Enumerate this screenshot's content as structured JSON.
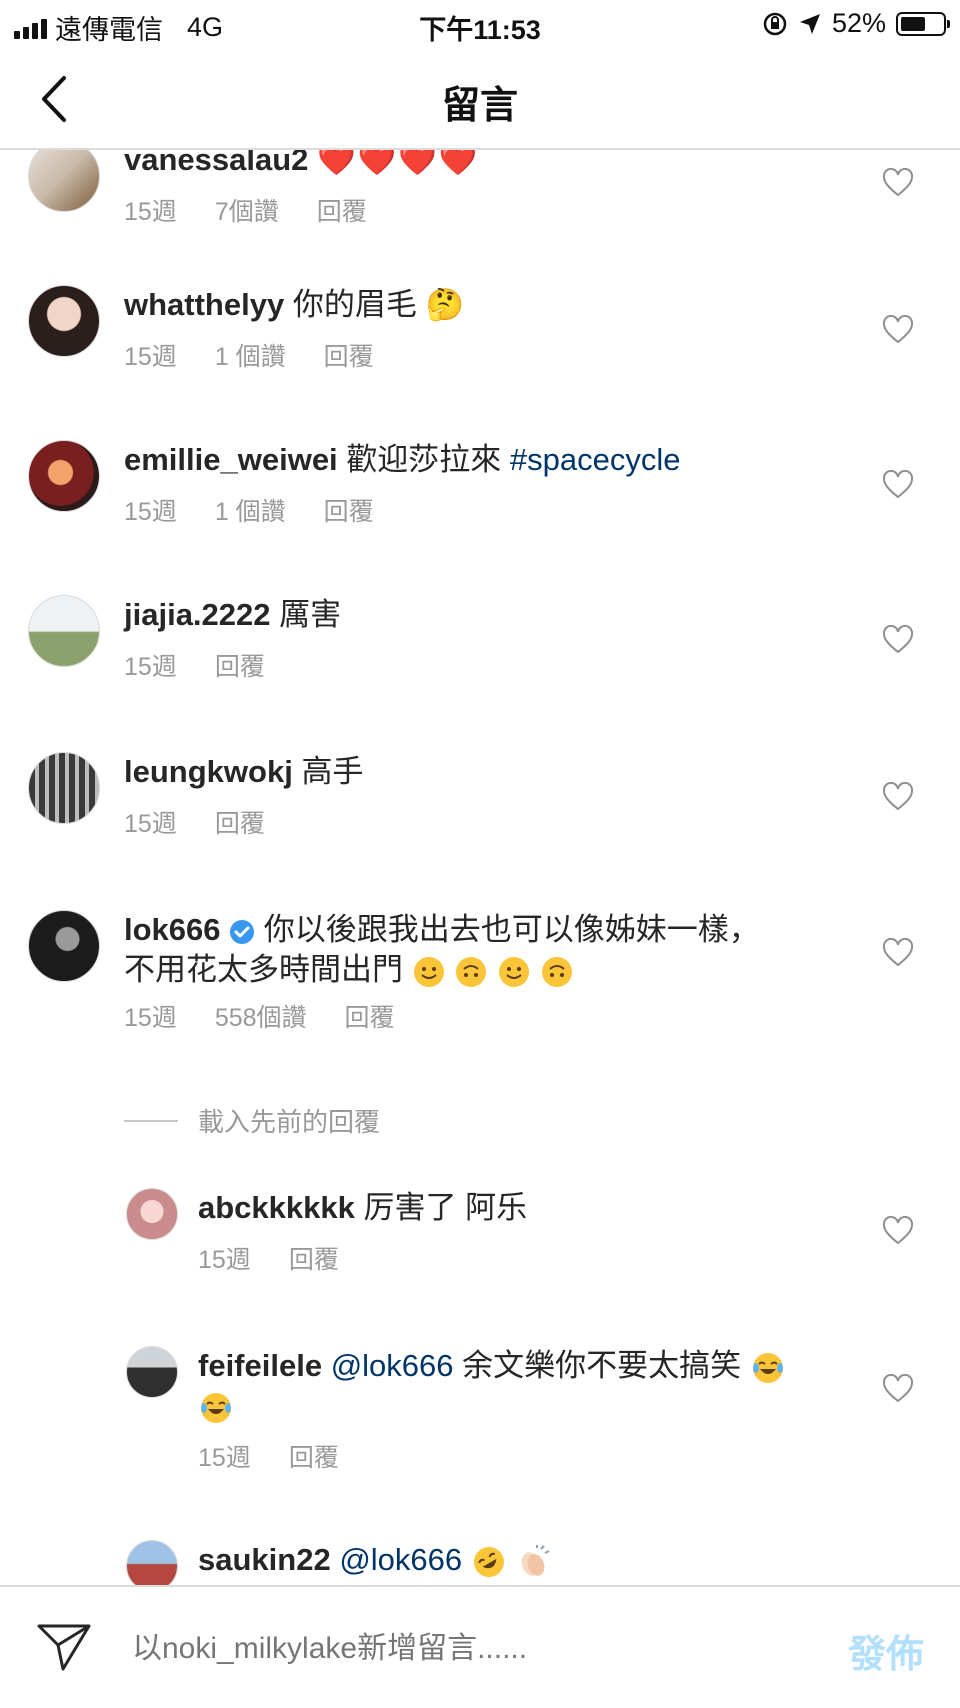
{
  "status_bar": {
    "carrier": "遠傳電信",
    "network": "4G",
    "time": "下午11:53",
    "battery": "52%"
  },
  "nav": {
    "title": "留言"
  },
  "comments": [
    {
      "username": "vanessalau2",
      "text": "",
      "emoji": "❤️❤️❤️❤️",
      "time": "15週",
      "likes": "7個讚",
      "reply": "回覆"
    },
    {
      "username": "whatthelyy",
      "text": "你的眉毛",
      "emoji": "🤔",
      "time": "15週",
      "likes": "1 個讚",
      "reply": "回覆"
    },
    {
      "username": "emillie_weiwei",
      "text": "歡迎莎拉來",
      "hashtag": "#spacecycle",
      "time": "15週",
      "likes": "1 個讚",
      "reply": "回覆"
    },
    {
      "username": "jiajia.2222",
      "text": "厲害",
      "time": "15週",
      "reply": "回覆"
    },
    {
      "username": "leungkwokj",
      "text": "高手",
      "time": "15週",
      "reply": "回覆"
    },
    {
      "username": "lok666",
      "text_line1": "你以後跟我出去也可以像姊妹一樣，",
      "text_line2": "不用花太多時間出門",
      "time": "15週",
      "likes": "558個讚",
      "reply": "回覆"
    }
  ],
  "load_previous": "載入先前的回覆",
  "replies": [
    {
      "username": "abckkkkkk",
      "text": "厉害了 阿乐",
      "time": "15週",
      "reply": "回覆"
    },
    {
      "username": "feifeilele",
      "mention": "@lok666",
      "text": "余文樂你不要太搞笑",
      "time": "15週",
      "reply": "回覆"
    },
    {
      "username": "saukin22",
      "mention": "@lok666"
    }
  ],
  "input": {
    "placeholder": "以noki_milkylake新增留言......",
    "post_label": "發佈"
  },
  "colors": {
    "link": "#003569",
    "meta": "#999999",
    "post_disabled": "#b2dffc",
    "verified": "#3897f0"
  }
}
